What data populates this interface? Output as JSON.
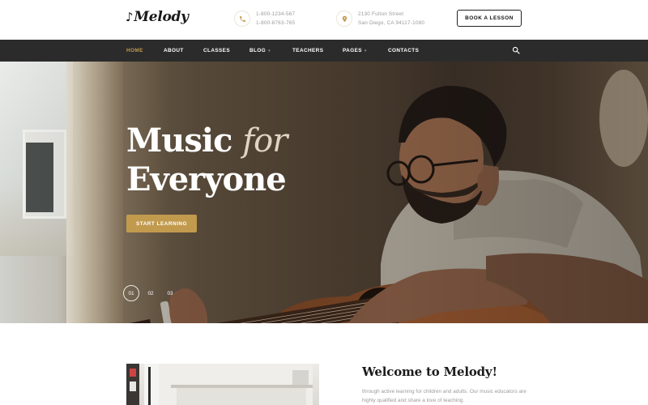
{
  "brand": {
    "logo_text": "Melody",
    "logo_note": "♪"
  },
  "header": {
    "phone_lines": [
      "1-800-1234-567",
      "1-800-8763-765"
    ],
    "address_lines": [
      "2130 Fulton Street",
      "San Diego, CA 94117-1080"
    ],
    "book_button": "BOOK A LESSON"
  },
  "nav": {
    "items": [
      {
        "label": "HOME",
        "active": true
      },
      {
        "label": "ABOUT"
      },
      {
        "label": "CLASSES"
      },
      {
        "label": "BLOG",
        "caret": "▾"
      },
      {
        "label": "TEACHERS"
      },
      {
        "label": "PAGES",
        "caret": "▾"
      },
      {
        "label": "CONTACTS"
      }
    ],
    "search_icon": "search-icon"
  },
  "hero": {
    "title_line1_a": "Music",
    "title_line1_b": "for",
    "title_line2": "Everyone",
    "cta": "START LEARNING",
    "slides": [
      "01",
      "02",
      "03"
    ],
    "active_slide": "01"
  },
  "about": {
    "heading": "Welcome to Melody!",
    "text": "through active learning for children and adults. Our music educators are highly qualified and share a love of teaching."
  },
  "colors": {
    "accent": "#c19a4d",
    "nav_bg": "#2b2b2b"
  }
}
